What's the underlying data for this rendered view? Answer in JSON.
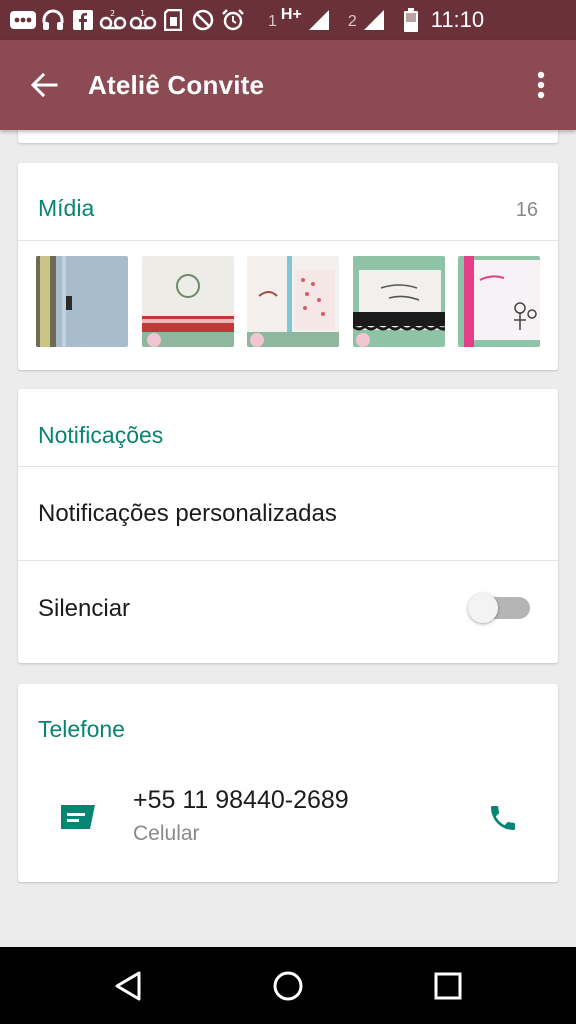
{
  "status_bar": {
    "icons": [
      "voicemail-icon",
      "headset-icon",
      "facebook-icon",
      "voicemail2-icon",
      "voicemail1-icon",
      "sim-card-icon",
      "do-not-disturb-icon",
      "alarm-icon"
    ],
    "sim1_label": "1",
    "network_type": "H+",
    "sim2_label": "2",
    "time": "11:10"
  },
  "app_bar": {
    "title": "Ateliê Convite",
    "back_icon": "arrow-back-icon",
    "menu_icon": "more-vert-icon"
  },
  "media": {
    "title": "Mídia",
    "count": "16",
    "thumbnails": [
      {
        "name": "media-thumb-1",
        "colors": [
          "#9fb3c6",
          "#b8b58a"
        ]
      },
      {
        "name": "media-thumb-2",
        "colors": [
          "#f4f2ee",
          "#c33a3a"
        ]
      },
      {
        "name": "media-thumb-3",
        "colors": [
          "#f4f0ec",
          "#d85a6a"
        ]
      },
      {
        "name": "media-thumb-4",
        "colors": [
          "#f1f0ec",
          "#1b1b1b"
        ]
      },
      {
        "name": "media-thumb-5",
        "colors": [
          "#f7f2f5",
          "#e53d86"
        ]
      }
    ]
  },
  "notifications": {
    "title": "Notificações",
    "custom_label": "Notificações personalizadas",
    "mute_label": "Silenciar",
    "mute_on": false
  },
  "phone": {
    "title": "Telefone",
    "number": "+55 11 98440-2689",
    "type": "Celular",
    "message_icon": "message-icon",
    "call_icon": "phone-icon"
  },
  "nav_bar": {
    "back_icon": "nav-back-icon",
    "home_icon": "nav-home-icon",
    "recents_icon": "nav-recents-icon"
  },
  "colors": {
    "status_bar": "#6b3138",
    "app_bar": "#8c4a53",
    "accent": "#078572"
  }
}
